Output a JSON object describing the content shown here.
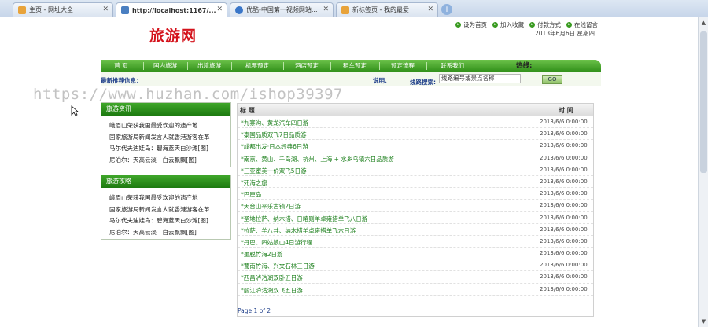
{
  "browser": {
    "tabs": [
      {
        "label": "主页 - 网址大全",
        "icon": "home-icon",
        "color": "#e8a33a"
      },
      {
        "label": "http://localhost:1167/...",
        "icon": "page-icon",
        "color": "#4a7fc1"
      },
      {
        "label": "优酷-中国第一视频网站...",
        "icon": "youku-icon",
        "color": "#3a76c8"
      },
      {
        "label": "新标签页 - 我的最爱",
        "icon": "newtab-icon",
        "color": "#e8a33a"
      }
    ],
    "new_tab_symbol": "+"
  },
  "header": {
    "logo": "旅游网",
    "links": [
      "设为首页",
      "加入收藏",
      "付款方式",
      "在线留言"
    ],
    "date": "2013年6月6日 星期四"
  },
  "nav": {
    "items": [
      "首 页",
      "国内旅游",
      "出境旅游",
      "机票预定",
      "酒店预定",
      "租车预定",
      "预定流程",
      "联系我们"
    ],
    "hotline_label": "热线:"
  },
  "subbar": {
    "latest_label": "最新推荐信息：",
    "desc_label": "说明、",
    "search_label": "线路搜索:",
    "search_value": "线路编号或景点名称",
    "go_label": "GO"
  },
  "watermark": "https://www.huzhan.com/ishop39397",
  "news_box": {
    "title": "旅游资讯",
    "items": [
      "峨眉山荣获我国最受欢迎的遗产地",
      "国家旅游局新闻发言人就香港游客在革",
      "马尔代夫迪娃岛：碧海蓝天白沙滩[图]",
      "尼泊尔：天高云淡　白云飘飘[图]"
    ]
  },
  "guide_box": {
    "title": "旅游攻略",
    "items": [
      "峨眉山荣获我国最受欢迎的遗产地",
      "国家旅游局新闻发言人就香港游客在革",
      "马尔代夫迪娃岛：碧海蓝天白沙滩[图]",
      "尼泊尔：天高云淡　白云飘飘[图]"
    ]
  },
  "routes_table": {
    "col_title": "标 题",
    "col_time": "时 间",
    "rows": [
      {
        "title": "*九寨沟、黄龙汽车四日游",
        "time": "2013/6/6 0:00:00"
      },
      {
        "title": "*泰国品质双飞7日品质游",
        "time": "2013/6/6 0:00:00"
      },
      {
        "title": "*成都出发·日本经典6日游",
        "time": "2013/6/6 0:00:00"
      },
      {
        "title": "*南京、黄山、千岛湖、杭州、上海 + 水乡乌镇六日品质游",
        "time": "2013/6/6 0:00:00"
      },
      {
        "title": "*三亚蜜美一价双飞5日游",
        "time": "2013/6/6 0:00:00"
      },
      {
        "title": "*死海之旅",
        "time": "2013/6/6 0:00:00"
      },
      {
        "title": "*巴厘岛",
        "time": "2013/6/6 0:00:00"
      },
      {
        "title": "*天台山平乐古镇2日游",
        "time": "2013/6/6 0:00:00"
      },
      {
        "title": "*圣地拉萨、纳木措、日喀则羊卓雍措单飞八日游",
        "time": "2013/6/6 0:00:00"
      },
      {
        "title": "*拉萨、羊八井、纳木措羊卓雍措单飞六日游",
        "time": "2013/6/6 0:00:00"
      },
      {
        "title": "*丹巴、四姑娘山4日游行程",
        "time": "2013/6/6 0:00:00"
      },
      {
        "title": "*墨脱竹海2日游",
        "time": "2013/6/6 0:00:00"
      },
      {
        "title": "*蜀南竹海、兴文石林三日游",
        "time": "2013/6/6 0:00:00"
      },
      {
        "title": "*西昌泸沽湖双卧五日游",
        "time": "2013/6/6 0:00:00"
      },
      {
        "title": "*丽江泸沽湖双飞五日游",
        "time": "2013/6/6 0:00:00"
      }
    ],
    "pager": "Page 1 of 2"
  },
  "colors": {
    "nav_green": "#2f8e18",
    "logo_red": "#d4121b",
    "route_link_green": "#1b7f1b"
  }
}
